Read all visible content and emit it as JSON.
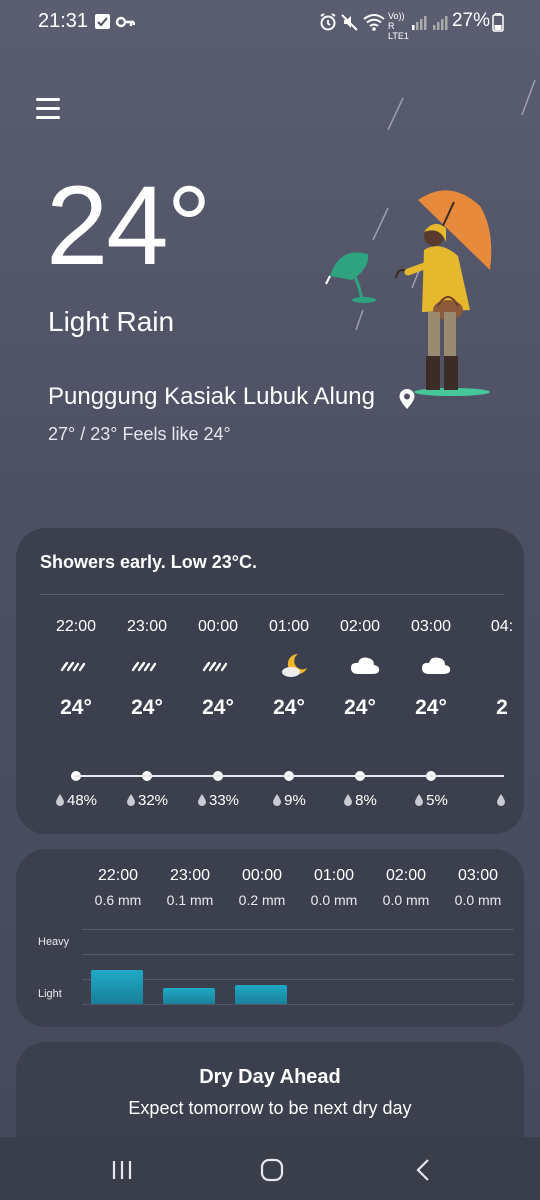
{
  "status_bar": {
    "time": "21:31",
    "battery": "27%",
    "network_label": "Vo)) R LTE1"
  },
  "current": {
    "temperature": "24°",
    "condition": "Light Rain",
    "location": "Punggung Kasiak Lubuk Alung",
    "hilo_feels": "27° / 23° Feels like 24°"
  },
  "hourly": {
    "summary": "Showers early. Low 23°C.",
    "hours": [
      {
        "time": "22:00",
        "icon": "rain-icon",
        "temp": "24°",
        "pop": "48%"
      },
      {
        "time": "23:00",
        "icon": "rain-icon",
        "temp": "24°",
        "pop": "32%"
      },
      {
        "time": "00:00",
        "icon": "rain-icon",
        "temp": "24°",
        "pop": "33%"
      },
      {
        "time": "01:00",
        "icon": "moon-cloud-icon",
        "temp": "24°",
        "pop": "9%"
      },
      {
        "time": "02:00",
        "icon": "cloud-icon",
        "temp": "24°",
        "pop": "8%"
      },
      {
        "time": "03:00",
        "icon": "cloud-icon",
        "temp": "24°",
        "pop": "5%"
      },
      {
        "time": "04:",
        "icon": "moon-icon",
        "temp": "2",
        "pop": ""
      }
    ]
  },
  "precip_amounts": {
    "levels": [
      "Heavy",
      "Light"
    ],
    "hours": [
      {
        "time": "22:00",
        "amount": "0.6 mm",
        "value_mm": 0.6
      },
      {
        "time": "23:00",
        "amount": "0.1 mm",
        "value_mm": 0.1
      },
      {
        "time": "00:00",
        "amount": "0.2 mm",
        "value_mm": 0.2
      },
      {
        "time": "01:00",
        "amount": "0.0 mm",
        "value_mm": 0.0
      },
      {
        "time": "02:00",
        "amount": "0.0 mm",
        "value_mm": 0.0
      },
      {
        "time": "03:00",
        "amount": "0.0 mm",
        "value_mm": 0.0
      }
    ]
  },
  "dry_day": {
    "title": "Dry Day Ahead",
    "text": "Expect tomorrow to be next dry day"
  },
  "colors": {
    "precip_bar": "#1fa9c6",
    "card_bg": "#3c3f4d",
    "umbrella": "#e88a3c",
    "raincoat": "#e6b82e"
  }
}
